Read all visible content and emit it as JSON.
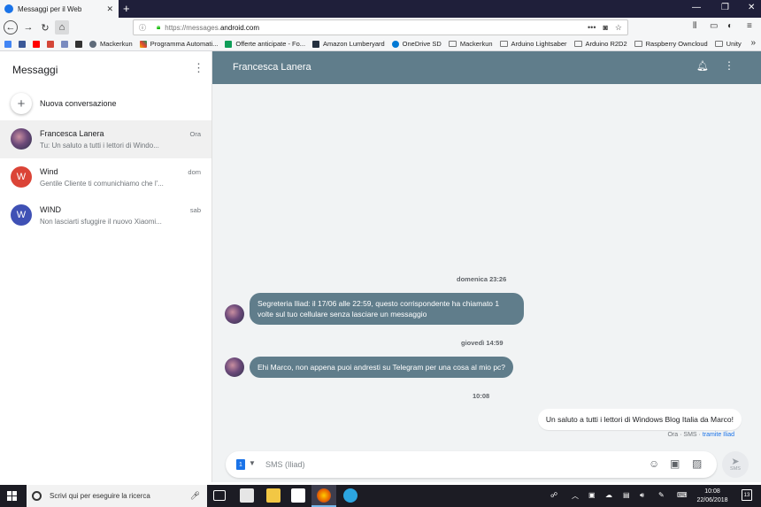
{
  "browser": {
    "tab_title": "Messaggi per il Web",
    "url_scheme": "https://messages.",
    "url_host": "android.com",
    "url_rest": "",
    "bookmarks": [
      {
        "label": "Mackerkun",
        "icon": "globe-icon"
      },
      {
        "label": "Programma Automati...",
        "icon": "colorful-icon"
      },
      {
        "label": "Offerte anticipate - Fo...",
        "icon": "green-doc-icon"
      },
      {
        "label": "Amazon Lumberyard",
        "icon": "amazon-icon"
      },
      {
        "label": "OneDrive SD",
        "icon": "cloud-icon"
      },
      {
        "label": "Mackerkun",
        "icon": "folder-icon"
      },
      {
        "label": "Arduino Lightsaber",
        "icon": "folder-icon"
      },
      {
        "label": "Arduino R2D2",
        "icon": "folder-icon"
      },
      {
        "label": "Raspberry Owncloud",
        "icon": "folder-icon"
      },
      {
        "label": "Unity",
        "icon": "folder-icon"
      }
    ]
  },
  "sidebar": {
    "title": "Messaggi",
    "new_conversation": "Nuova conversazione",
    "conversations": [
      {
        "name": "Francesca Lanera",
        "snippet": "Tu: Un saluto a tutti i lettori di Windo...",
        "time": "Ora",
        "avatar": "photo",
        "selected": true
      },
      {
        "name": "Wind",
        "snippet": "Gentile Cliente ti comunichiamo che l'...",
        "time": "dom",
        "avatar_letter": "W",
        "avatar_color": "#db4437"
      },
      {
        "name": "WIND",
        "snippet": "Non lasciarti sfuggire il nuovo Xiaomi...",
        "time": "sab",
        "avatar_letter": "W",
        "avatar_color": "#3f51b5"
      }
    ]
  },
  "chat": {
    "contact_name": "Francesca Lanera",
    "header_color": "#607d8b",
    "messages": [
      {
        "type": "day",
        "text": "domenica 23:26"
      },
      {
        "type": "in",
        "lines": [
          "Segreteria Iliad: il 17/06 alle 22:59, questo corrispondente ha chiamato 1",
          "volte sul tuo cellulare senza lasciare un messaggio"
        ]
      },
      {
        "type": "day",
        "text": "giovedì 14:59"
      },
      {
        "type": "in",
        "lines": [
          "Ehi Marco, non appena puoi andresti su Telegram per una cosa al mio pc?"
        ]
      },
      {
        "type": "day",
        "text": "10:08"
      },
      {
        "type": "out",
        "lines": [
          "Un saluto a tutti i lettori di Windows Blog Italia da Marco!"
        ]
      }
    ],
    "out_meta": "Ora · SMS ·",
    "out_meta_via": "tramite Iliad"
  },
  "compose": {
    "sim_number": "1",
    "placeholder": "SMS (Iliad)",
    "send_label": "SMS"
  },
  "taskbar": {
    "search_placeholder": "Scrivi qui per eseguire la ricerca",
    "time": "10:08",
    "date": "22/06/2018",
    "notification_count": "13"
  }
}
